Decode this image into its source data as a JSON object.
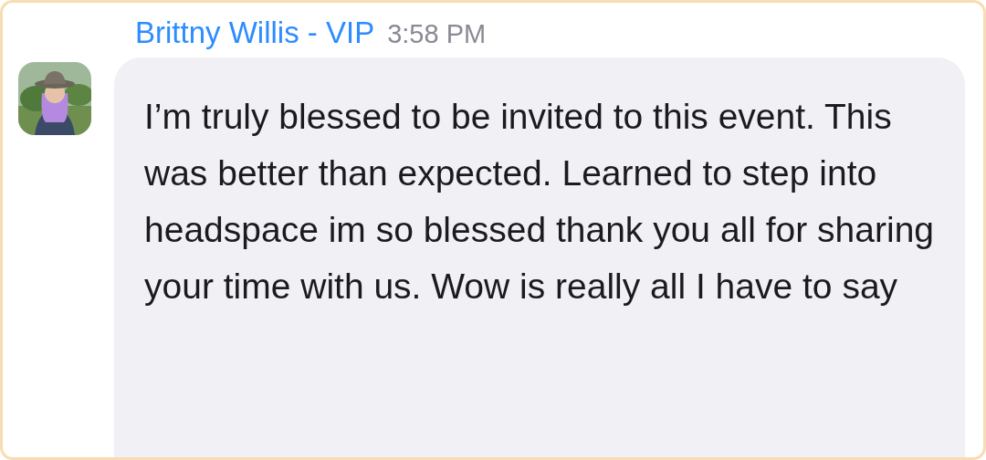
{
  "message": {
    "sender": "Brittny Willis - VIP",
    "time": "3:58 PM",
    "text": "I’m truly blessed to be invited to this event. This was better than expected. Learned to step into headspace im so blessed thank you all for sharing your time with us. Wow is really all I have to say"
  }
}
